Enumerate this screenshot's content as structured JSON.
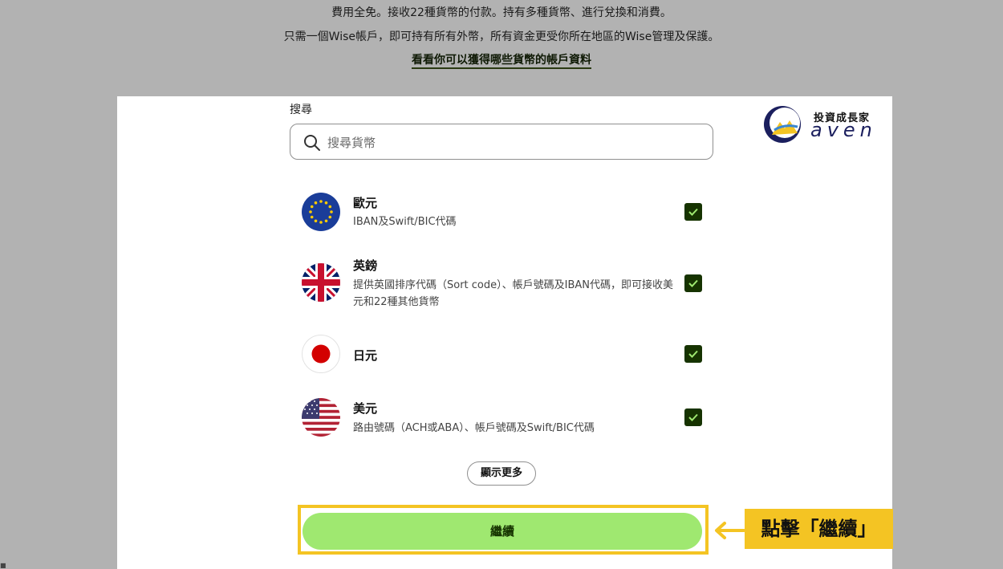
{
  "intro": {
    "line1": "費用全免。接收22種貨幣的付款。持有多種貨幣、進行兌換和消費。",
    "line2": "只需一個Wise帳戶，即可持有所有外幣，所有資金更受你所在地區的Wise管理及保護。",
    "link": "看看你可以獲得哪些貨幣的帳戶資料"
  },
  "search": {
    "label": "搜尋",
    "placeholder": "搜尋貨幣"
  },
  "currencies": [
    {
      "name": "歐元",
      "desc": "IBAN及Swift/BIC代碼",
      "checked": true,
      "flag_icon": "eu-flag-icon"
    },
    {
      "name": "英鎊",
      "desc": "提供英國排序代碼（Sort code）、帳戶號碼及IBAN代碼，即可接收美元和22種其他貨幣",
      "checked": true,
      "flag_icon": "uk-flag-icon"
    },
    {
      "name": "日元",
      "desc": "",
      "checked": true,
      "flag_icon": "japan-flag-icon"
    },
    {
      "name": "美元",
      "desc": "路由號碼（ACH或ABA）、帳戶號碼及Swift/BIC代碼",
      "checked": true,
      "flag_icon": "us-flag-icon"
    }
  ],
  "buttons": {
    "show_more": "顯示更多",
    "continue": "繼續"
  },
  "annotation": {
    "callout": "點擊「繼續」"
  },
  "logo": {
    "title": "投資成長家",
    "word": "aven"
  },
  "colors": {
    "overlay": "#b2b2b2",
    "checkbox": "#163300",
    "continue_button": "#9fe870",
    "highlight": "#f4c423",
    "logo_blue": "#1b1f5e"
  }
}
